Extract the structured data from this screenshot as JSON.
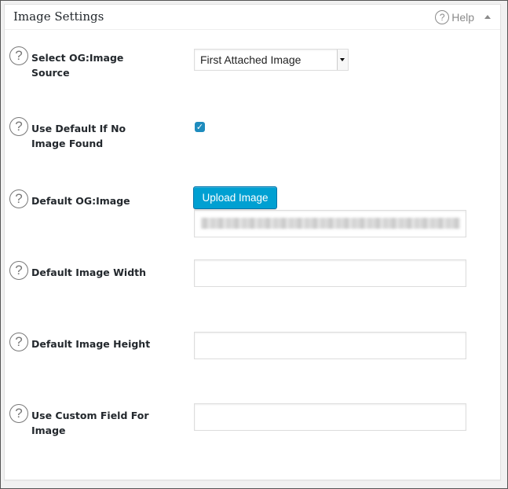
{
  "panel": {
    "title": "Image Settings",
    "help_label": "Help",
    "help_icon_glyph": "?"
  },
  "rows": [
    {
      "label": "Select OG:Image Source",
      "icon": "?"
    },
    {
      "label": "Use Default If No Image Found",
      "icon": "?"
    },
    {
      "label": "Default OG:Image",
      "icon": "?"
    },
    {
      "label": "Default Image Width",
      "icon": "?"
    },
    {
      "label": "Default Image Height",
      "icon": "?"
    },
    {
      "label": "Use Custom Field For Image",
      "icon": "?"
    }
  ],
  "fields": {
    "image_source": {
      "value": "First Attached Image"
    },
    "use_default": {
      "checked": true,
      "check_glyph": "✓"
    },
    "upload_button": {
      "label": "Upload Image"
    },
    "default_image_url": {
      "value": ""
    },
    "width": {
      "value": "",
      "placeholder": ""
    },
    "height": {
      "value": "",
      "placeholder": ""
    },
    "custom_field": {
      "value": "",
      "placeholder": ""
    }
  },
  "colors": {
    "accent": "#00a0d2",
    "checkbox": "#1e8cbe"
  }
}
